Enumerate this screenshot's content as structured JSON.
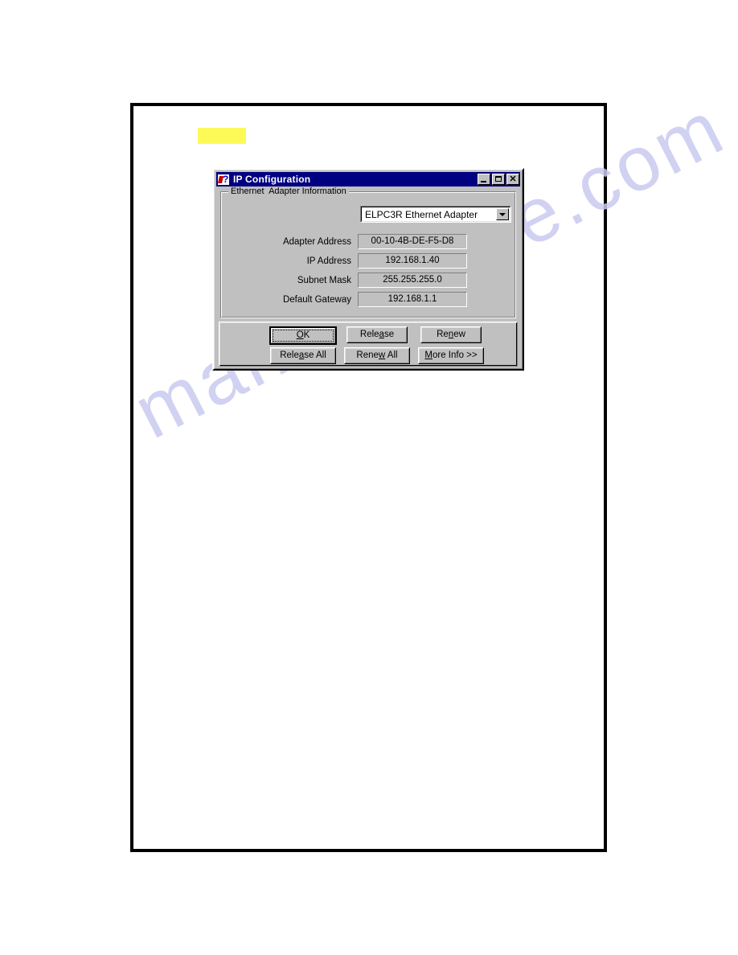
{
  "page": {
    "watermark_text": "manualshive.com",
    "highlight_color": "#fdfa58"
  },
  "dialog": {
    "title": "IP Configuration",
    "icon": "ip-config-icon",
    "window_controls": [
      {
        "name": "minimize",
        "glyph": "_"
      },
      {
        "name": "maximize",
        "glyph": "[]"
      },
      {
        "name": "close",
        "glyph": "×"
      }
    ],
    "group": {
      "label": "Ethernet  Adapter Information",
      "adapter_select": {
        "value": "ELPC3R Ethernet Adapter",
        "options": [
          "ELPC3R Ethernet Adapter"
        ]
      },
      "fields": [
        {
          "label": "Adapter Address",
          "value": "00-10-4B-DE-F5-D8"
        },
        {
          "label": "IP Address",
          "value": "192.168.1.40"
        },
        {
          "label": "Subnet Mask",
          "value": "255.255.255.0"
        },
        {
          "label": "Default Gateway",
          "value": "192.168.1.1"
        }
      ]
    },
    "buttons": {
      "ok": {
        "before": "",
        "accel": "O",
        "after": "K"
      },
      "release": {
        "before": "Rele",
        "accel": "a",
        "after": "se"
      },
      "renew": {
        "before": "Re",
        "accel": "n",
        "after": "ew"
      },
      "release_all": {
        "before": "Rele",
        "accel": "a",
        "after": "se All"
      },
      "renew_all": {
        "before": "Rene",
        "accel": "w",
        "after": " All"
      },
      "more_info": {
        "before": "",
        "accel": "M",
        "after": "ore Info >>"
      }
    },
    "colors": {
      "titlebar": "#000080",
      "face": "#c0c0c0",
      "field": "#c0c0c0",
      "combo": "#ffffff"
    }
  }
}
